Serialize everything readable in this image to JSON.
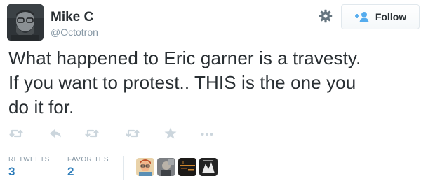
{
  "user": {
    "name": "Mike C",
    "handle": "@Octotron"
  },
  "follow_button": {
    "label": "Follow"
  },
  "tweet": {
    "lines": [
      "What happened to Eric garner is a travesty.",
      "If you want to protest.. THIS is the one you",
      "do it for."
    ]
  },
  "actions": [
    "retweet-icon",
    "reply-icon",
    "retweet-icon",
    "retweet-icon",
    "favorite-star-icon",
    "more-icon"
  ],
  "stats": {
    "retweets": {
      "label": "RETWEETS",
      "value": "3"
    },
    "favorites": {
      "label": "FAVORITES",
      "value": "2"
    }
  },
  "colors": {
    "text": "#292f33",
    "muted": "#8899a6",
    "link": "#2b7bb9",
    "action_icon": "#ccd6dd",
    "follow_icon": "#55acee"
  }
}
